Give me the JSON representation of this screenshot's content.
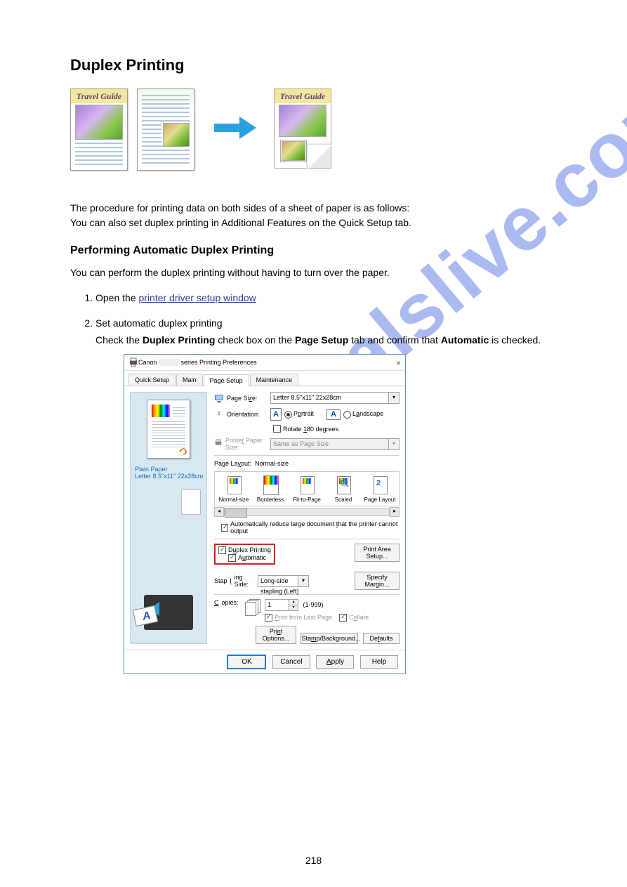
{
  "page": {
    "heading": "Duplex Printing",
    "intro_text": "The procedure for printing data on both sides of a sheet of paper is as follows:\nYou can also set duplex printing in Additional Features on the Quick Setup tab.",
    "step1_title": "Performing Automatic Duplex Printing",
    "step1_desc": "You can perform the duplex printing without having to turn over the paper.",
    "step1_sub1": "Open the ",
    "step1_link": "printer driver setup window",
    "step1_sub2": "Set automatic duplex printing",
    "step1_sub2_desc": "Check the Duplex Printing check box on the Page Setup tab and confirm that Automatic is checked.",
    "number": "218"
  },
  "illustration": {
    "cover_title": "Travel Guide"
  },
  "dialog": {
    "title_prefix": "Canon ",
    "title_suffix": " series Printing Preferences",
    "close_icon": "×",
    "tabs": {
      "quick": "Quick Setup",
      "main": "Main",
      "page": "Page Setup",
      "maint": "Maintenance"
    },
    "left": {
      "paper_type": "Plain Paper",
      "paper_size": "Letter 8.5\"x11\" 22x28cm"
    },
    "right": {
      "page_size_label": "Page Size:",
      "page_size_value": "Letter 8.5\"x11\" 22x28cm",
      "orientation_label": "Orientation:",
      "portrait": "Portrait",
      "landscape": "Landscape",
      "rotate": "Rotate 180 degrees",
      "printer_paper_label": "Printer Paper Size:",
      "printer_paper_value": "Same as Page Size",
      "layout_label": "Page Layout:",
      "layout_value": "Normal-size",
      "thumbs": {
        "normal": "Normal-size",
        "borderless": "Borderless",
        "fit": "Fit-to-Page",
        "scaled": "Scaled",
        "pagelayout": "Page Layout"
      },
      "auto_reduce": "Automatically reduce large document that the printer cannot output",
      "duplex": "Duplex Printing",
      "automatic": "Automatic",
      "print_area_btn": "Print Area Setup...",
      "stapling_label": "Stapling Side:",
      "stapling_value": "Long-side stapling (Left)",
      "margin_btn": "Specify Margin...",
      "copies_label": "Copies:",
      "copies_value": "1",
      "copies_range": "(1-999)",
      "print_last": "Print from Last Page",
      "collate": "Collate",
      "print_options": "Print Options...",
      "stamp_bg": "Stamp/Background...",
      "defaults": "Defaults"
    },
    "footer": {
      "ok": "OK",
      "cancel": "Cancel",
      "apply": "Apply",
      "help": "Help"
    }
  },
  "watermark": "manualslive.com"
}
